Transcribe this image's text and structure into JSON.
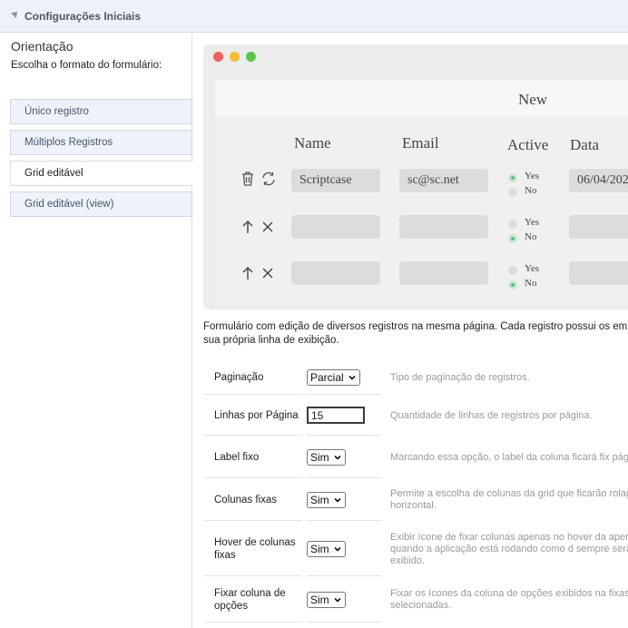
{
  "header": {
    "title": "Configurações Iniciais"
  },
  "sidebar": {
    "heading": "Orientação",
    "subtitle": "Escolha o formato do formulário:",
    "options": [
      {
        "label": "Único registro"
      },
      {
        "label": "Múltiplos Registros"
      },
      {
        "label": "Grid editável",
        "selected": true
      },
      {
        "label": "Grid editável (view)"
      }
    ]
  },
  "preview": {
    "title": "New",
    "columns": [
      "Name",
      "Email",
      "Active",
      "Data"
    ],
    "rows": [
      {
        "name": "Scriptcase",
        "email": "sc@sc.net",
        "yes": "Yes",
        "no": "No",
        "active": "Yes",
        "date": "06/04/202"
      },
      {
        "name": "",
        "email": "",
        "yes": "Yes",
        "no": "No",
        "active": "No",
        "date": ""
      },
      {
        "name": "",
        "email": "",
        "yes": "Yes",
        "no": "No",
        "active": "No",
        "date": ""
      }
    ]
  },
  "description": "Formulário com edição de diversos registros na mesma página. Cada registro possui os em sua própria linha de exibição.",
  "settings": [
    {
      "label": "Paginação",
      "type": "select",
      "value": "Parcial",
      "help": "Tipo de paginação de registros."
    },
    {
      "label": "Linhas por Página",
      "type": "text",
      "value": "15",
      "help": "Quantidade de linhas de registros por página."
    },
    {
      "label": "Label fixo",
      "type": "select",
      "value": "Sim",
      "help": "Marcando essa opção, o label da coluna ficará fix página."
    },
    {
      "label": "Colunas fixas",
      "type": "select",
      "value": "Sim",
      "help": "Permite a escolha de colunas da grid que ficarão rolagem horizontal."
    },
    {
      "label": "Hover de colunas fixas",
      "type": "select",
      "value": "Sim",
      "help": "Exibir ícone de fixar colunas apenas no hover da apenas quando a aplicação está rodando como d sempre será exibido."
    },
    {
      "label": "Fixar coluna de opções",
      "type": "select",
      "value": "Sim",
      "help": "Fixar os ícones da coluna de opções exibidos na fixas selecionadas."
    }
  ],
  "colors": {
    "accent_green": "#5dbd7c",
    "sidebar_bg": "#eef2f9"
  }
}
